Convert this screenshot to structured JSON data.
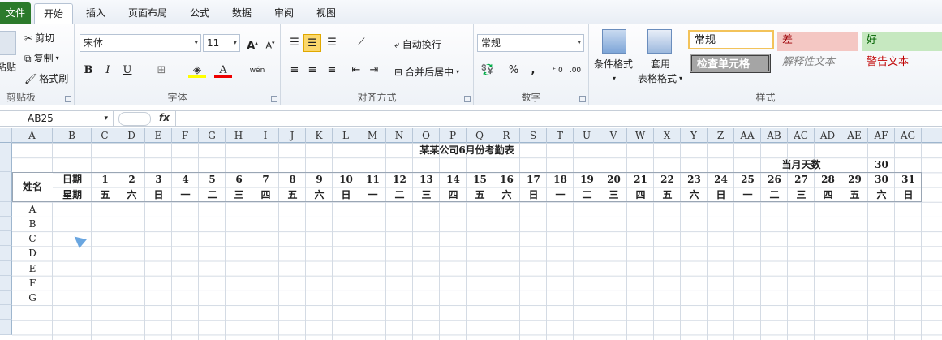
{
  "tabs": {
    "file": "文件",
    "items": [
      "开始",
      "插入",
      "页面布局",
      "公式",
      "数据",
      "审阅",
      "视图"
    ]
  },
  "clipboard": {
    "paste": "粘贴",
    "cut": "剪切",
    "copy": "复制",
    "painter": "格式刷",
    "group": "剪贴板"
  },
  "font": {
    "name": "宋体",
    "size": "11",
    "bold": "B",
    "italic": "I",
    "underline": "U",
    "color_a": "A",
    "phonetic": "wén",
    "group": "字体"
  },
  "alignment": {
    "wrap": "自动换行",
    "merge": "合并后居中",
    "group": "对齐方式"
  },
  "number": {
    "format": "常规",
    "percent": "%",
    "comma": ",",
    "group": "数字"
  },
  "styles": {
    "conditional": "条件格式",
    "table_line1": "套用",
    "table_line2": "表格格式",
    "normal": "常规",
    "bad": "差",
    "good": "好",
    "check": "检查单元格",
    "explain": "解释性文本",
    "warning": "警告文本",
    "group": "样式"
  },
  "namebox": "AB25",
  "fx": "fx",
  "columns": [
    "A",
    "B",
    "C",
    "D",
    "E",
    "F",
    "G",
    "H",
    "I",
    "J",
    "K",
    "L",
    "M",
    "N",
    "O",
    "P",
    "Q",
    "R",
    "S",
    "T",
    "U",
    "V",
    "W",
    "X",
    "Y",
    "Z",
    "AA",
    "AB",
    "AC",
    "AD",
    "AE",
    "AF",
    "AG"
  ],
  "row_numbers": [
    "",
    "",
    "",
    "",
    "",
    "",
    "",
    "",
    "",
    "",
    "",
    ""
  ],
  "sheet": {
    "title": "某某公司6月份考勤表",
    "days_label": "当月天数",
    "days_value": "30",
    "name_header": "姓名",
    "date_label": "日期",
    "week_label": "星期",
    "dates": [
      "1",
      "2",
      "3",
      "4",
      "5",
      "6",
      "7",
      "8",
      "9",
      "10",
      "11",
      "12",
      "13",
      "14",
      "15",
      "16",
      "17",
      "18",
      "19",
      "20",
      "21",
      "22",
      "23",
      "24",
      "25",
      "26",
      "27",
      "28",
      "29",
      "30",
      "31"
    ],
    "weekdays": [
      "五",
      "六",
      "日",
      "一",
      "二",
      "三",
      "四",
      "五",
      "六",
      "日",
      "一",
      "二",
      "三",
      "四",
      "五",
      "六",
      "日",
      "一",
      "二",
      "三",
      "四",
      "五",
      "六",
      "日",
      "一",
      "二",
      "三",
      "四",
      "五",
      "六",
      "日"
    ],
    "names": [
      "A",
      "B",
      "C",
      "D",
      "E",
      "F",
      "G"
    ]
  },
  "colors": {
    "accent": "#2b7a2b",
    "bad": "#f4c7c3",
    "good": "#c6e8c0",
    "warning": "#c00000",
    "header": "#e4ecf5"
  }
}
